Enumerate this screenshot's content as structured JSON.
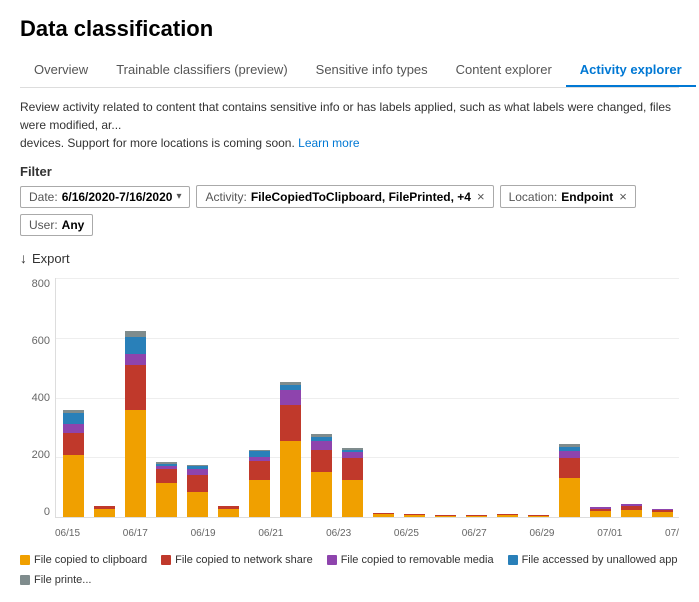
{
  "page": {
    "title": "Data classification"
  },
  "tabs": [
    {
      "id": "overview",
      "label": "Overview",
      "active": false
    },
    {
      "id": "trainable",
      "label": "Trainable classifiers (preview)",
      "active": false
    },
    {
      "id": "sensitive",
      "label": "Sensitive info types",
      "active": false
    },
    {
      "id": "content",
      "label": "Content explorer",
      "active": false
    },
    {
      "id": "activity",
      "label": "Activity explorer",
      "active": true
    }
  ],
  "description": "Review activity related to content that contains sensitive info or has labels applied, such as what labels were changed, files were modified, ar... devices. Support for more locations is coming soon.",
  "learn_more": "Learn more",
  "filter": {
    "label": "Filter",
    "chips": [
      {
        "key": "Date",
        "value": "6/16/2020-7/16/2020",
        "has_arrow": true,
        "has_x": false
      },
      {
        "key": "Activity",
        "value": "FileCopiedToClipboard, FilePrinted, +4",
        "has_arrow": false,
        "has_x": true
      },
      {
        "key": "Location",
        "value": "Endpoint",
        "has_arrow": false,
        "has_x": true
      },
      {
        "key": "User",
        "value": "Any",
        "has_arrow": false,
        "has_x": false
      }
    ]
  },
  "export": {
    "label": "Export"
  },
  "chart": {
    "yaxis": [
      "800",
      "600",
      "400",
      "200",
      "0"
    ],
    "xaxis": [
      "06/15",
      "06/17",
      "06/19",
      "06/21",
      "06/23",
      "06/25",
      "06/27",
      "06/29",
      "07/01",
      "07/"
    ],
    "colors": {
      "clipboard": "#f0a000",
      "network": "#c0392b",
      "removable": "#8e44ad",
      "unallowed": "#2980b9",
      "printed": "#7f8c8d"
    },
    "bars": [
      {
        "date": "06/15",
        "clipboard": 220,
        "network": 80,
        "removable": 30,
        "unallowed": 40,
        "printed": 10
      },
      {
        "date": "06/16",
        "clipboard": 30,
        "network": 10,
        "removable": 0,
        "unallowed": 0,
        "printed": 0
      },
      {
        "date": "06/17",
        "clipboard": 380,
        "network": 160,
        "removable": 40,
        "unallowed": 60,
        "printed": 20
      },
      {
        "date": "06/18",
        "clipboard": 120,
        "network": 50,
        "removable": 10,
        "unallowed": 10,
        "printed": 5
      },
      {
        "date": "06/19",
        "clipboard": 90,
        "network": 60,
        "removable": 20,
        "unallowed": 10,
        "printed": 5
      },
      {
        "date": "06/20",
        "clipboard": 30,
        "network": 10,
        "removable": 0,
        "unallowed": 0,
        "printed": 0
      },
      {
        "date": "06/21",
        "clipboard": 130,
        "network": 70,
        "removable": 15,
        "unallowed": 20,
        "printed": 5
      },
      {
        "date": "06/22",
        "clipboard": 270,
        "network": 130,
        "removable": 50,
        "unallowed": 20,
        "printed": 10
      },
      {
        "date": "06/23",
        "clipboard": 160,
        "network": 80,
        "removable": 30,
        "unallowed": 15,
        "printed": 10
      },
      {
        "date": "06/24",
        "clipboard": 130,
        "network": 80,
        "removable": 20,
        "unallowed": 10,
        "printed": 5
      },
      {
        "date": "06/25",
        "clipboard": 10,
        "network": 5,
        "removable": 0,
        "unallowed": 0,
        "printed": 0
      },
      {
        "date": "06/26",
        "clipboard": 8,
        "network": 4,
        "removable": 0,
        "unallowed": 0,
        "printed": 0
      },
      {
        "date": "06/27",
        "clipboard": 5,
        "network": 2,
        "removable": 0,
        "unallowed": 0,
        "printed": 0
      },
      {
        "date": "06/28",
        "clipboard": 5,
        "network": 3,
        "removable": 0,
        "unallowed": 0,
        "printed": 0
      },
      {
        "date": "06/29",
        "clipboard": 6,
        "network": 2,
        "removable": 0,
        "unallowed": 0,
        "printed": 0
      },
      {
        "date": "06/30",
        "clipboard": 5,
        "network": 2,
        "removable": 0,
        "unallowed": 0,
        "printed": 0
      },
      {
        "date": "07/01",
        "clipboard": 140,
        "network": 70,
        "removable": 25,
        "unallowed": 15,
        "printed": 10
      },
      {
        "date": "07/02",
        "clipboard": 20,
        "network": 10,
        "removable": 5,
        "unallowed": 0,
        "printed": 0
      },
      {
        "date": "07/03",
        "clipboard": 25,
        "network": 15,
        "removable": 5,
        "unallowed": 0,
        "printed": 0
      },
      {
        "date": "07/",
        "clipboard": 18,
        "network": 8,
        "removable": 3,
        "unallowed": 0,
        "printed": 0
      }
    ],
    "max": 800
  },
  "legend": [
    {
      "color": "#f0a000",
      "label": "File copied to clipboard"
    },
    {
      "color": "#c0392b",
      "label": "File copied to network share"
    },
    {
      "color": "#8e44ad",
      "label": "File copied to removable media"
    },
    {
      "color": "#2980b9",
      "label": "File accessed by unallowed app"
    },
    {
      "color": "#7f8c8d",
      "label": "File printe..."
    }
  ]
}
